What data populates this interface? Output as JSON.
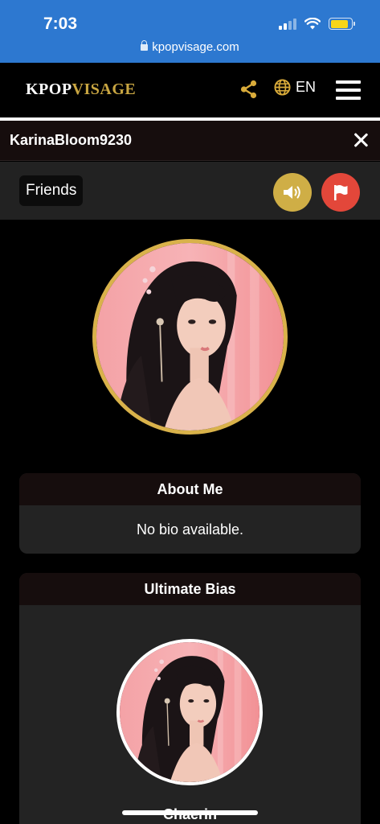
{
  "status_bar": {
    "time": "7:03",
    "url": "kpopvisage.com",
    "battery_level": 0.85,
    "battery_color": "#f6d619",
    "signal_bars": 2,
    "background": "#2d78d0"
  },
  "header": {
    "logo_part1": "KPOP",
    "logo_part2": "VISAGE",
    "brand_gold": "#c9a642",
    "language": "EN",
    "icons": [
      "share-icon",
      "globe-icon",
      "hamburger-menu-icon"
    ]
  },
  "profile": {
    "username": "KarinaBloom9230",
    "friends_label": "Friends",
    "sound_color": "#cfae46",
    "flag_color": "#e3473a"
  },
  "about": {
    "title": "About Me",
    "bio": "No bio available."
  },
  "bias": {
    "title": "Ultimate Bias",
    "name": "Chaerin"
  }
}
